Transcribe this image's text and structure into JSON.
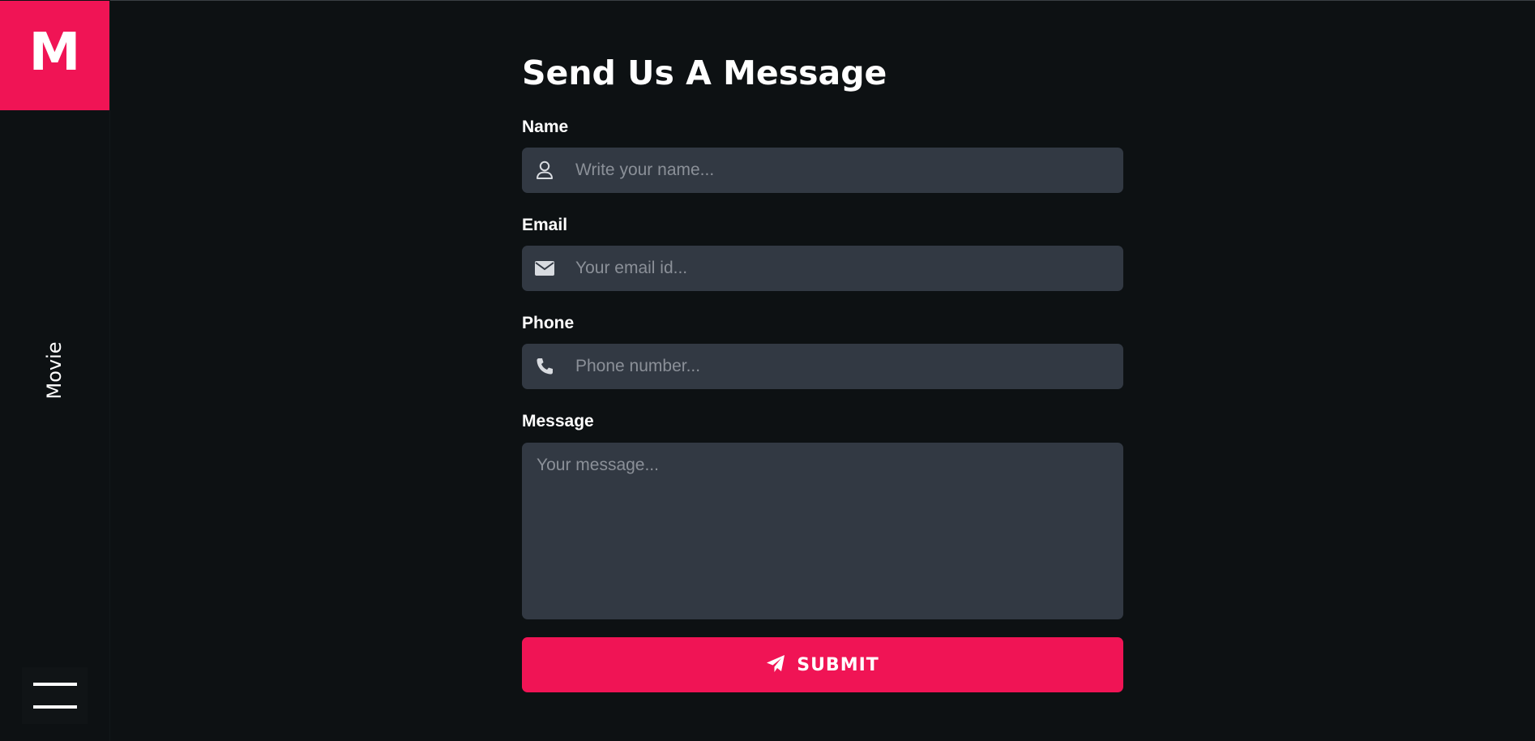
{
  "brand": {
    "logo_letter": "M",
    "side_label": "Movie",
    "accent_color": "#f01455"
  },
  "sidebar": {
    "menu_icon": "hamburger-menu-icon"
  },
  "form": {
    "title": "Send Us A Message",
    "fields": {
      "name": {
        "label": "Name",
        "placeholder": "Write your name...",
        "value": "",
        "icon": "user-icon"
      },
      "email": {
        "label": "Email",
        "placeholder": "Your email id...",
        "value": "",
        "icon": "envelope-icon"
      },
      "phone": {
        "label": "Phone",
        "placeholder": "Phone number...",
        "value": "",
        "icon": "phone-icon"
      },
      "message": {
        "label": "Message",
        "placeholder": "Your message...",
        "value": ""
      }
    },
    "submit": {
      "label": "SUBMIT",
      "icon": "paper-plane-icon"
    }
  }
}
